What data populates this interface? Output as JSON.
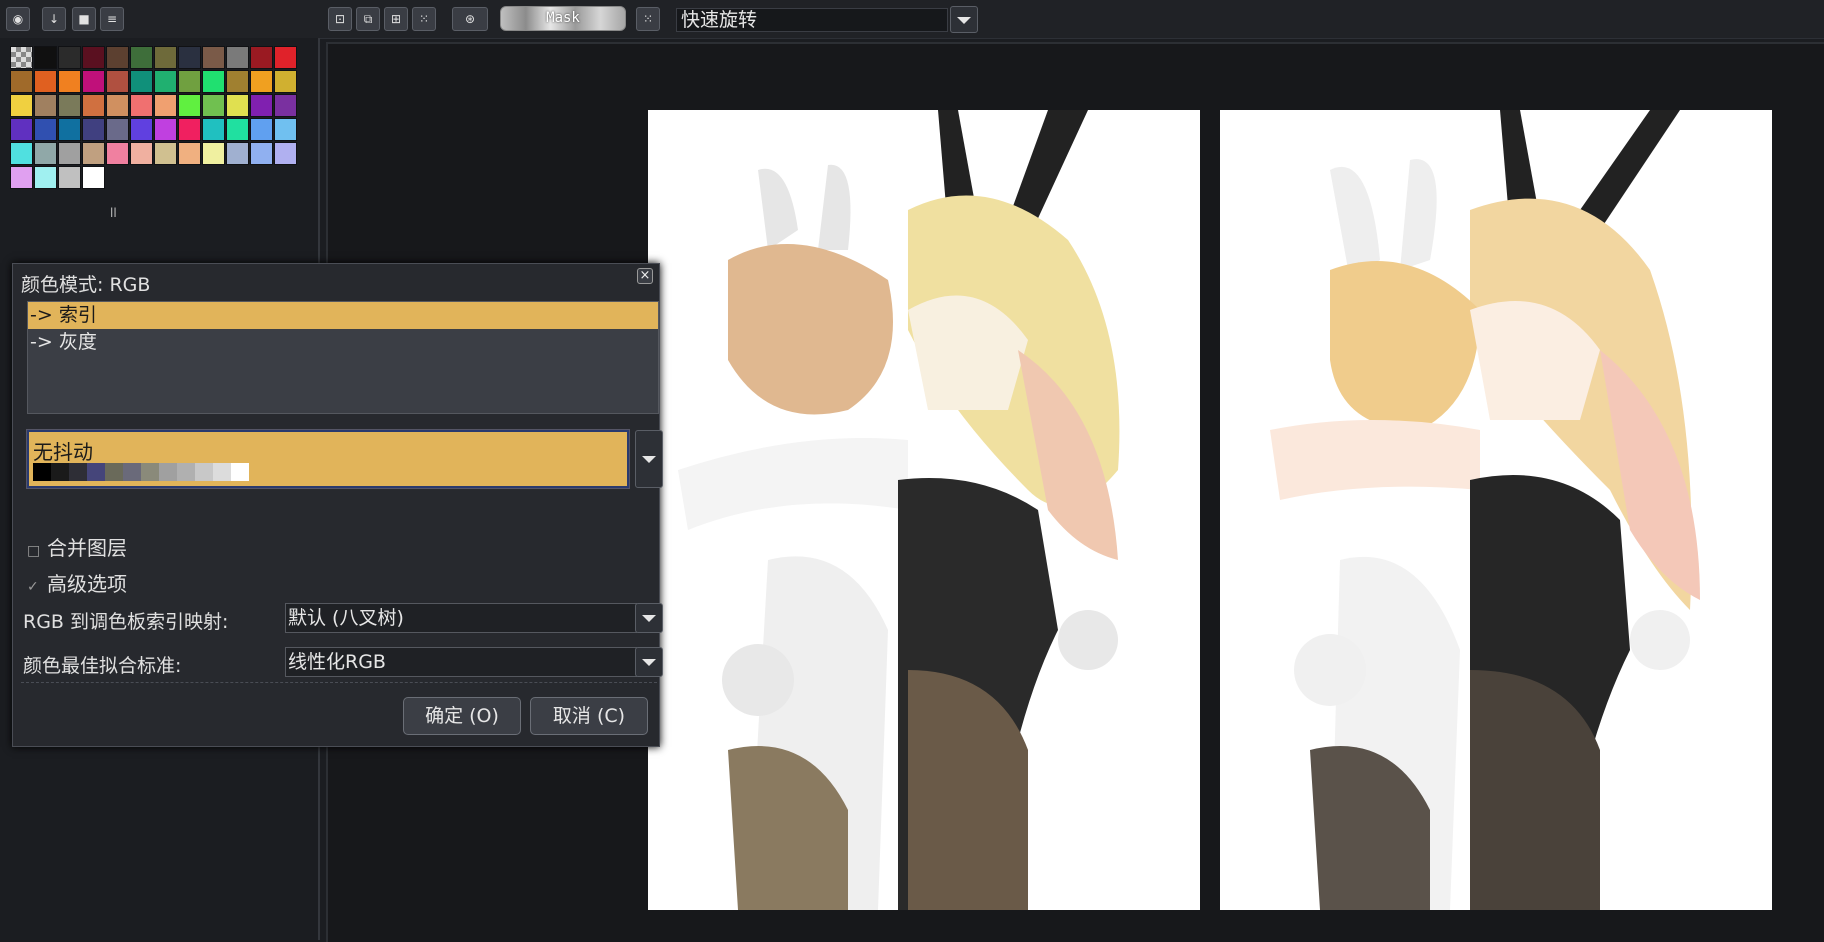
{
  "toolbar": {
    "mask_label": "Mask",
    "quick_select_value": "快速旋转",
    "icons": [
      "layers-icon",
      "down-arrow-icon",
      "file-icon",
      "menu-icon",
      "select-icon",
      "copy-icon",
      "paste-icon",
      "grid-icon",
      "crop-icon",
      "grid-icon"
    ]
  },
  "palette": {
    "colors": [
      [
        "#9a9a9a",
        "#101010",
        "#2b2b2b",
        "#5a1020",
        "#5c4030",
        "#3e6e3a",
        "#6e6a3a",
        "#2a3040",
        "#7a5a48",
        "#7a7a7a",
        "#9a1a22",
        "#e0222a"
      ],
      [
        "#a06a2a",
        "#e06020",
        "#f08020",
        "#c0107a",
        "#b05040",
        "#10907a",
        "#20b070",
        "#70a040",
        "#20e070",
        "#a08030",
        "#f0a020",
        "#d0b030"
      ],
      [
        "#f0d040",
        "#a08060",
        "#7a7a5a",
        "#d07040",
        "#d09060",
        "#f07070",
        "#f0a070",
        "#60f040",
        "#70c050",
        "#e0e050",
        "#8020b0",
        "#7a30a0"
      ],
      [
        "#6030c0",
        "#3050b0",
        "#1070a0",
        "#404080",
        "#6a6a8a",
        "#6040e0",
        "#c040e0",
        "#f02060",
        "#20c0c0",
        "#20e0a0",
        "#60a0f0",
        "#70c0f0"
      ],
      [
        "#50e0e0",
        "#90a8a8",
        "#a0a0a0",
        "#c0a080",
        "#f080a0",
        "#f0b0a0",
        "#d0c090",
        "#f0b080",
        "#f0f0a0",
        "#a0b0d0",
        "#90b0f0",
        "#b0b0f0"
      ],
      [
        "#e0a0f0",
        "#a0f0f0",
        "#c0c0c0",
        "#ffffff"
      ]
    ],
    "marker": "ll"
  },
  "dialog": {
    "title": "颜色模式: RGB",
    "close_label": "×",
    "modes": [
      "-> 索引",
      "-> 灰度"
    ],
    "dither_label": "无抖动",
    "dither_strip": [
      "#000000",
      "#1a1a1a",
      "#2e2e36",
      "#45457a",
      "#6a6a5a",
      "#6a6a7a",
      "#8a8a7a",
      "#a0a0a0",
      "#b0b0b0",
      "#c8c8c8",
      "#dcdcdc",
      "#ffffff"
    ],
    "merge_layers_label": "合并图层",
    "merge_layers_checked": false,
    "advanced_label": "高级选项",
    "advanced_checked": true,
    "mapping_label": "RGB 到调色板索引映射:",
    "mapping_value": "默认 (八叉树)",
    "fit_label": "颜色最佳拟合标准:",
    "fit_value": "线性化RGB",
    "ok_label": "确定 (O)",
    "cancel_label": "取消 (C)"
  },
  "canvas": {
    "left_image": "pixelated-bunny-girls-illustration",
    "right_image": "bunny-girls-illustration"
  }
}
